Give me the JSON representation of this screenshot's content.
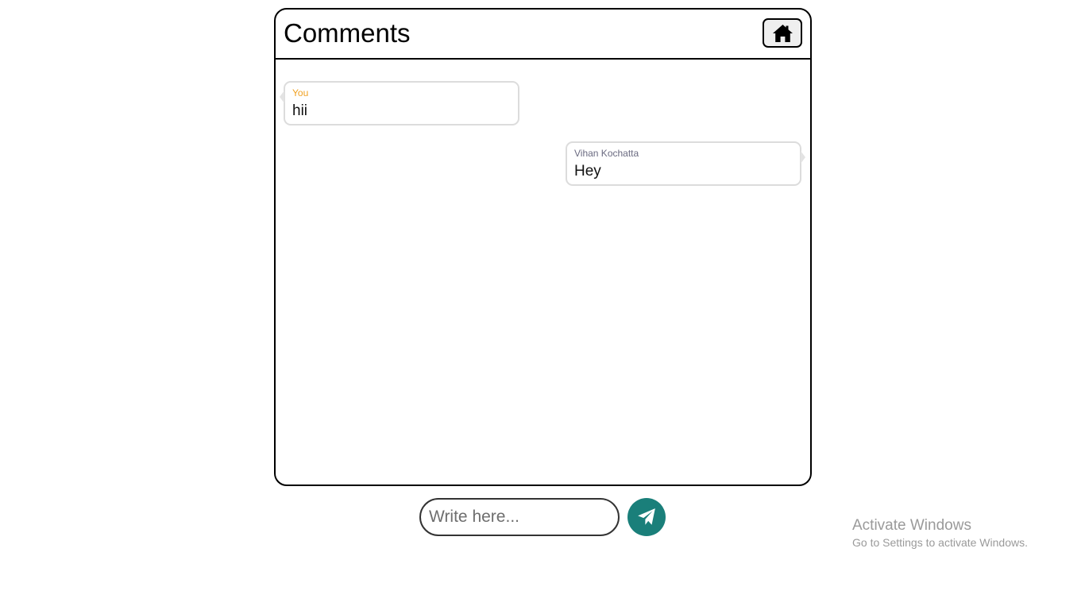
{
  "header": {
    "title": "Comments",
    "home_icon": "home-icon"
  },
  "messages": [
    {
      "author": "You",
      "text": "hii",
      "author_color": "#f0a020",
      "side": "left"
    },
    {
      "author": "Vihan Kochatta",
      "text": "Hey",
      "author_color": "#6a6a80",
      "side": "right"
    }
  ],
  "composer": {
    "placeholder": "Write here...",
    "value": "",
    "send_icon": "paper-plane-icon",
    "send_color": "#1a7f7a"
  },
  "watermark": {
    "title": "Activate Windows",
    "subtitle": "Go to Settings to activate Windows."
  }
}
